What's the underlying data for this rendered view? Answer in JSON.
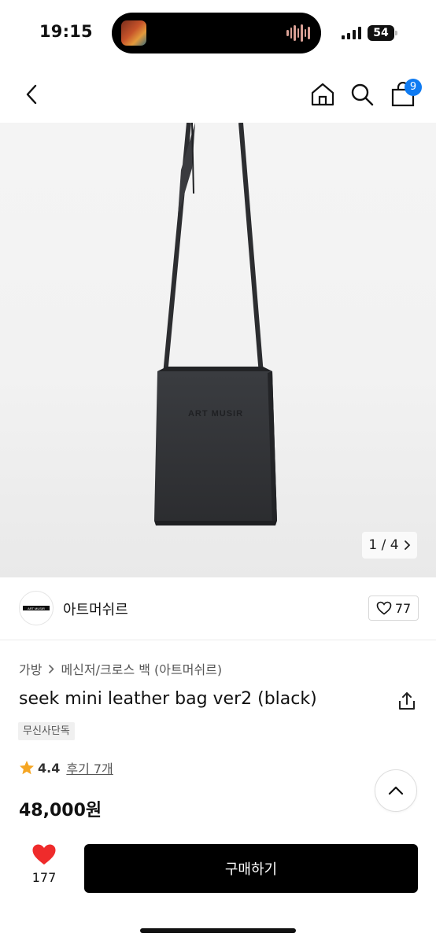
{
  "status_bar": {
    "time": "19:15",
    "battery": "54",
    "icons": [
      "now-playing-artwork",
      "audio-waveform-icon",
      "cellular-signal-icon",
      "battery-icon"
    ]
  },
  "nav": {
    "icons": [
      "back-chevron-icon",
      "home-icon",
      "search-icon",
      "shopping-bag-icon"
    ],
    "cart_count": "9"
  },
  "gallery": {
    "counter": "1 / 4",
    "logo_text": "ART MUSIR"
  },
  "brand": {
    "name": "아트머쉬르",
    "likes": "77",
    "logo_text": "ART MUSIR"
  },
  "product": {
    "breadcrumb": [
      "가방",
      "메신저/크로스 백 (아트머쉬르)"
    ],
    "title": "seek mini leather bag ver2 (black)",
    "tag": "무신사단독",
    "rating": "4.4",
    "reviews": "후기 7개",
    "price": "48,000원"
  },
  "actions": {
    "wish_count": "177",
    "buy_label": "구매하기"
  },
  "colors": {
    "accent": "#0f7bf2",
    "heart": "#ef2b2b",
    "star": "#f5a623",
    "buy_bg": "#000000"
  }
}
